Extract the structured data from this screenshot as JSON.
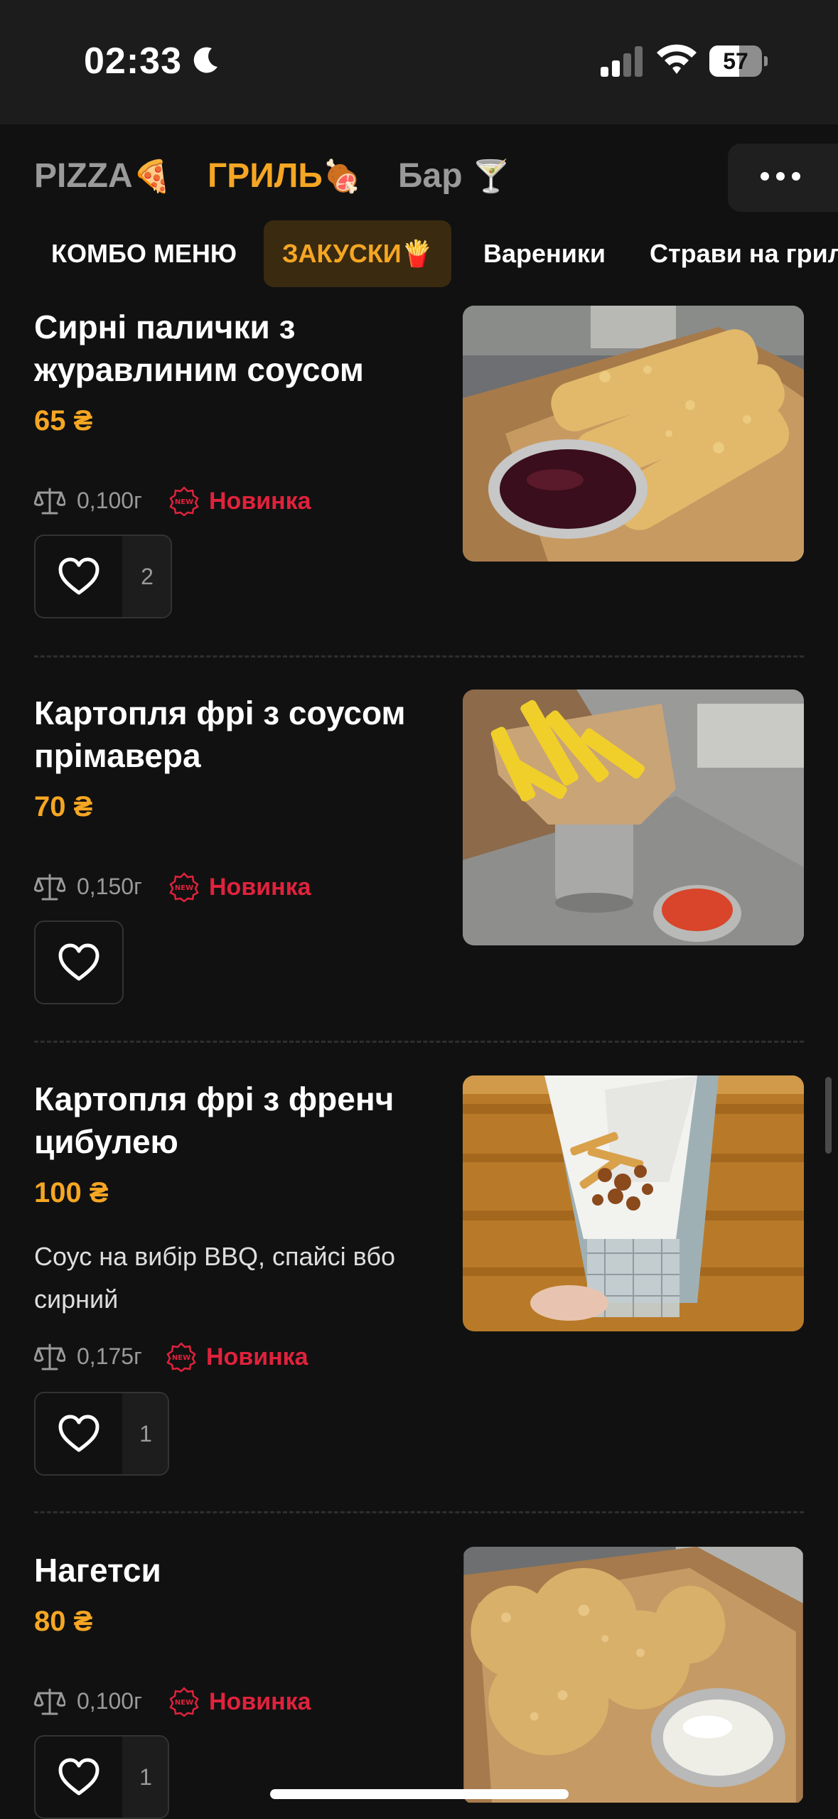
{
  "status": {
    "time": "02:33",
    "battery": "57",
    "battery_level_percent": 57
  },
  "main_tabs": [
    {
      "label": "PIZZA",
      "emoji": "🍕",
      "active": false
    },
    {
      "label": "ГРИЛЬ",
      "emoji": "🍖",
      "active": true
    },
    {
      "label": "Бар",
      "emoji": "🍸",
      "active": false
    }
  ],
  "more_icon": "more-dots-icon",
  "sub_tabs": [
    {
      "label": "КОМБО МЕНЮ",
      "active": false
    },
    {
      "label": "ЗАКУСКИ🍟",
      "active": true
    },
    {
      "label": "Вареники",
      "active": false
    },
    {
      "label": "Страви на гриль",
      "active": false
    }
  ],
  "items": [
    {
      "title": "Сирні палички з журавлиним соусом",
      "price": "65 ₴",
      "description": "",
      "weight": "0,100г",
      "badge": "Новинка",
      "likes": "2"
    },
    {
      "title": "Картопля фрі з соусом прімавера",
      "price": "70 ₴",
      "description": "",
      "weight": "0,150г",
      "badge": "Новинка",
      "likes": ""
    },
    {
      "title": "Картопля фрі з френч цибулею",
      "price": "100 ₴",
      "description": "Соус на вибір BBQ, спайсі вбо сирний",
      "weight": "0,175г",
      "badge": "Новинка",
      "likes": "1"
    },
    {
      "title": "Нагетси",
      "price": "80 ₴",
      "description": "",
      "weight": "0,100г",
      "badge": "Новинка",
      "likes": "1"
    }
  ],
  "colors": {
    "accent": "#f5a623",
    "badge": "#e0223c",
    "background": "#111111"
  }
}
